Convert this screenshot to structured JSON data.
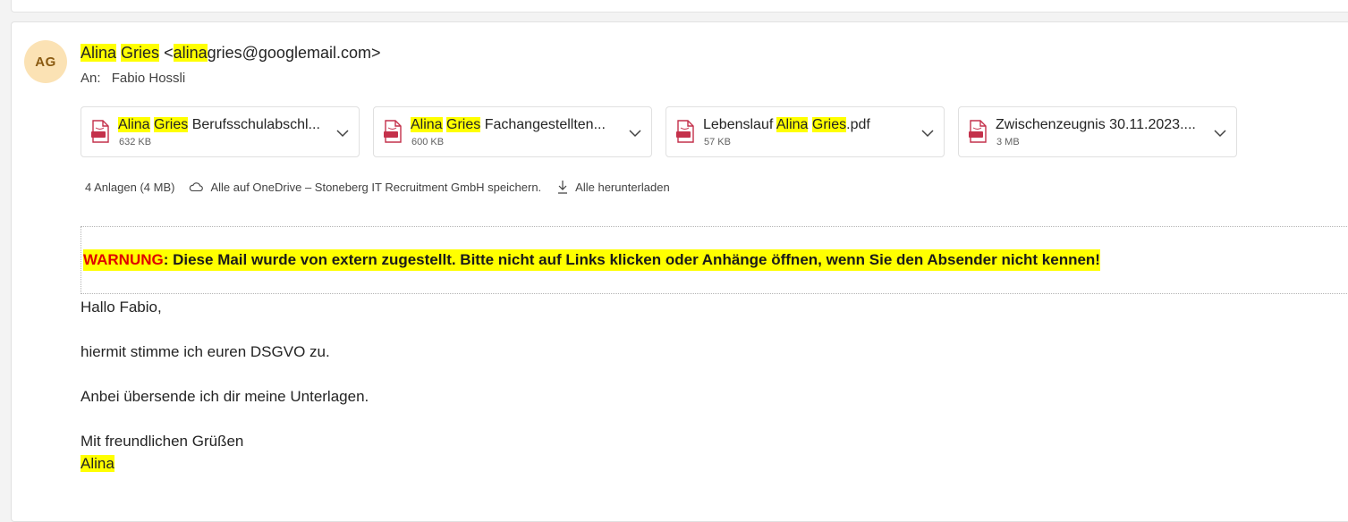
{
  "sender": {
    "avatar_initials": "AG",
    "first_name": "Alina",
    "last_name": "Gries",
    "email_prefix": "<",
    "email_highlight": "alina",
    "email_rest": "gries@googlemail.com>"
  },
  "recipients": {
    "label": "An:",
    "name": "Fabio Hossli"
  },
  "attachments": [
    {
      "hl1": "Alina",
      "hl2": "Gries",
      "text": " Berufsschulabschl...",
      "size": "632 KB"
    },
    {
      "hl1": "Alina",
      "hl2": "Gries",
      "text": " Fachangestellten...",
      "size": "600 KB"
    },
    {
      "prefix": "Lebenslauf ",
      "hl1": "Alina",
      "hl2": "Gries",
      "suffix": ".pdf",
      "size": "57 KB"
    },
    {
      "text": "Zwischenzeugnis 30.11.2023....",
      "size": "3 MB"
    }
  ],
  "attachment_actions": {
    "count_label": "4 Anlagen (4 MB)",
    "save_onedrive_label": "Alle auf OneDrive – Stoneberg IT Recruitment GmbH speichern.",
    "download_all_label": "Alle herunterladen"
  },
  "warning": {
    "label": "WARNUNG",
    "text": ": Diese Mail wurde von extern zugestellt. Bitte nicht auf Links klicken oder Anhänge öffnen, wenn Sie den Absender nicht kennen!"
  },
  "body": {
    "greeting": "Hallo Fabio,",
    "line1": "hiermit stimme ich euren DSGVO zu.",
    "line2": "Anbei übersende ich dir meine Unterlagen.",
    "closing": "Mit freundlichen Grüßen",
    "signature": "Alina"
  },
  "colors": {
    "highlight": "#ffff00",
    "warning_red": "#e00000",
    "avatar_bg": "#fbe2b4",
    "pdf_red": "#c4314b"
  },
  "icons": [
    "pdf-icon",
    "chevron-down-icon",
    "cloud-icon",
    "download-icon"
  ]
}
